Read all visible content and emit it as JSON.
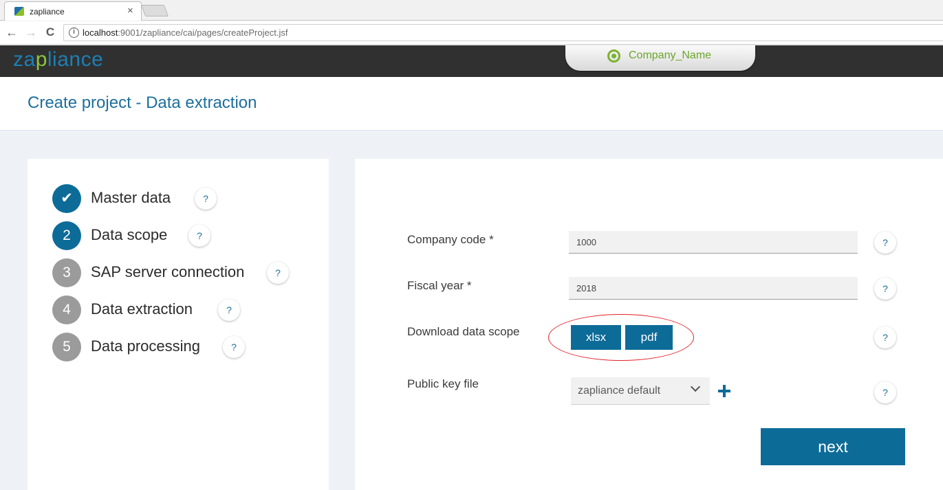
{
  "browser": {
    "tab_title": "zapliance",
    "tab_close": "×",
    "back": "←",
    "forward": "→",
    "reload": "C",
    "info": "i",
    "url_host": "localhost",
    "url_path": ":9001/zapliance/cai/pages/createProject.jsf"
  },
  "header": {
    "logo_part1": "za",
    "logo_part2": "p",
    "logo_part3": "liance",
    "company_name": "Company_Name"
  },
  "page": {
    "title": "Create project - Data extraction"
  },
  "steps": [
    {
      "number": "✔",
      "label": "Master data",
      "state": "done"
    },
    {
      "number": "2",
      "label": "Data scope",
      "state": "active"
    },
    {
      "number": "3",
      "label": "SAP server connection",
      "state": "pending"
    },
    {
      "number": "4",
      "label": "Data extraction",
      "state": "pending"
    },
    {
      "number": "5",
      "label": "Data processing",
      "state": "pending"
    }
  ],
  "help_glyph": "?",
  "form": {
    "company_code_label": "Company code *",
    "company_code_value": "1000",
    "fiscal_year_label": "Fiscal year *",
    "fiscal_year_value": "2018",
    "download_label": "Download data scope",
    "xlsx_label": "xlsx",
    "pdf_label": "pdf",
    "public_key_label": "Public key file",
    "public_key_value": "zapliance default",
    "next_label": "next"
  },
  "colors": {
    "accent": "#0d6b98",
    "brand_green": "#8dc63f",
    "highlight": "#e21f26"
  }
}
